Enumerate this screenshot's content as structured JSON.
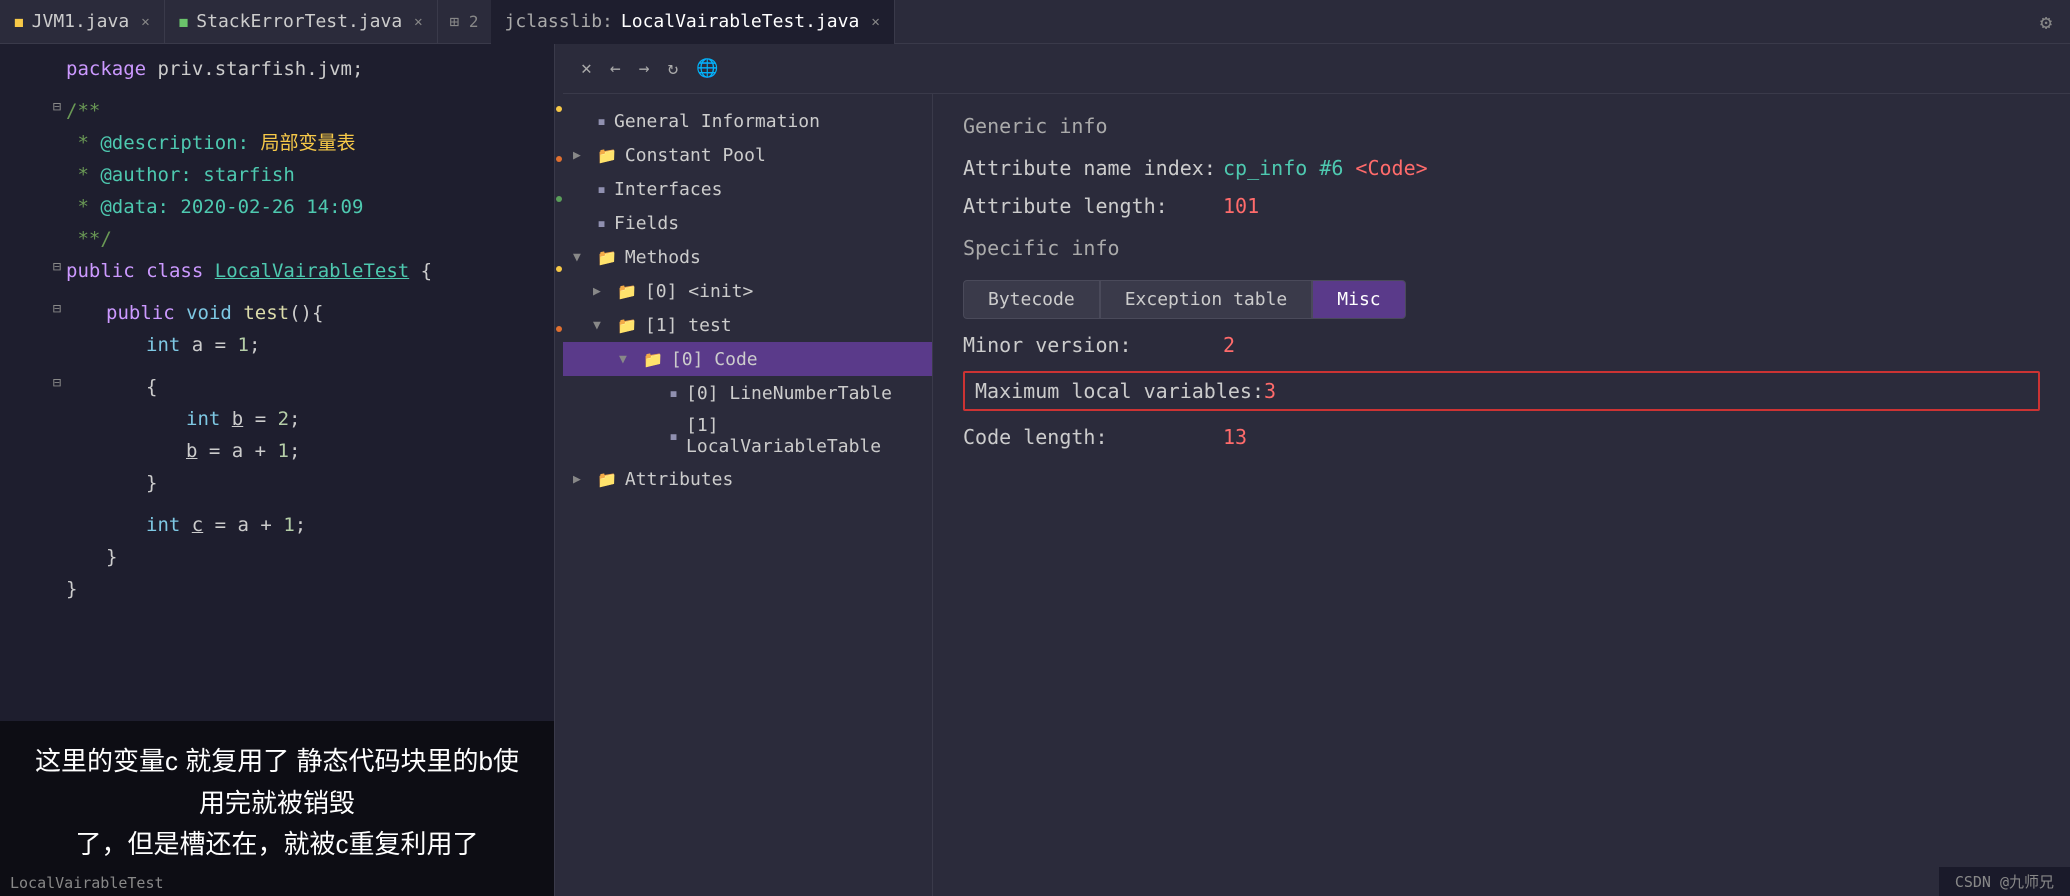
{
  "tabs": [
    {
      "id": "jvm1",
      "label": "JVM1.java",
      "icon": "js",
      "active": false
    },
    {
      "id": "stackerrortest",
      "label": "StackErrorTest.java",
      "icon": "green",
      "active": false
    },
    {
      "id": "jclasslib",
      "label": "jclasslib:",
      "icon": "none",
      "active": true
    },
    {
      "id": "localvairabletest",
      "label": "LocalVairableTest.java",
      "icon": "none",
      "active": true
    }
  ],
  "code": {
    "lines": [
      {
        "text": "package priv.starfish.jvm;",
        "type": "package"
      },
      {
        "text": "",
        "type": "blank"
      },
      {
        "text": "/**",
        "type": "comment"
      },
      {
        "text": " * @description: 局部变量表",
        "type": "comment-tag"
      },
      {
        "text": " * @author: starfish",
        "type": "comment-tag"
      },
      {
        "text": " * @data: 2020-02-26 14:09",
        "type": "comment-tag"
      },
      {
        "text": " **/",
        "type": "comment"
      },
      {
        "text": "public class LocalVairableTest {",
        "type": "class"
      },
      {
        "text": "",
        "type": "blank"
      },
      {
        "text": "    public void test(){",
        "type": "method"
      },
      {
        "text": "        int a = 1;",
        "type": "code"
      },
      {
        "text": "",
        "type": "blank"
      },
      {
        "text": "        {",
        "type": "code"
      },
      {
        "text": "            int b = 2;",
        "type": "code"
      },
      {
        "text": "            b = a + 1;",
        "type": "code"
      },
      {
        "text": "        }",
        "type": "code"
      },
      {
        "text": "",
        "type": "blank"
      },
      {
        "text": "        int c = a + 1;",
        "type": "code"
      },
      {
        "text": "    }",
        "type": "code"
      },
      {
        "text": "}",
        "type": "code"
      }
    ]
  },
  "annotation": "这里的变量c 就复用了 静态代码块里的b使用完就被销毁了，但是槽还在，就被c重复利用了",
  "tree": {
    "items": [
      {
        "id": "general-info",
        "label": "General Information",
        "indent": 0,
        "type": "file",
        "arrow": ""
      },
      {
        "id": "constant-pool",
        "label": "Constant Pool",
        "indent": 0,
        "type": "folder",
        "arrow": "▶"
      },
      {
        "id": "interfaces",
        "label": "Interfaces",
        "indent": 0,
        "type": "file",
        "arrow": ""
      },
      {
        "id": "fields",
        "label": "Fields",
        "indent": 0,
        "type": "file",
        "arrow": ""
      },
      {
        "id": "methods",
        "label": "Methods",
        "indent": 0,
        "type": "folder",
        "arrow": "▼"
      },
      {
        "id": "init",
        "label": "[0] <init>",
        "indent": 1,
        "type": "folder",
        "arrow": "▶"
      },
      {
        "id": "test",
        "label": "[1] test",
        "indent": 1,
        "type": "folder",
        "arrow": "▼"
      },
      {
        "id": "code",
        "label": "[0] Code",
        "indent": 2,
        "type": "folder",
        "arrow": "▼",
        "selected": true
      },
      {
        "id": "linenumber",
        "label": "[0] LineNumberTable",
        "indent": 3,
        "type": "file",
        "arrow": ""
      },
      {
        "id": "localvariable",
        "label": "[1] LocalVariableTable",
        "indent": 3,
        "type": "file",
        "arrow": ""
      },
      {
        "id": "attributes",
        "label": "Attributes",
        "indent": 0,
        "type": "folder",
        "arrow": "▶"
      }
    ]
  },
  "info": {
    "generic_info_title": "Generic info",
    "attribute_name_label": "Attribute name index:",
    "attribute_name_value": "cp_info #6",
    "attribute_name_code": "<Code>",
    "attribute_length_label": "Attribute length:",
    "attribute_length_value": "101",
    "specific_info_title": "Specific info",
    "tab_buttons": [
      "Bytecode",
      "Exception table",
      "Misc"
    ],
    "active_tab": "Misc",
    "minor_version_label": "Minor version:",
    "minor_version_value": "2",
    "max_local_label": "Maximum local variables:",
    "max_local_value": "3",
    "code_length_label": "Code length:",
    "code_length_value": "13"
  },
  "statusbar": {
    "text": "CSDN @九师兄"
  },
  "toolbar": {
    "close": "✕",
    "back": "←",
    "forward": "→",
    "refresh": "↻",
    "globe": "🌐"
  }
}
